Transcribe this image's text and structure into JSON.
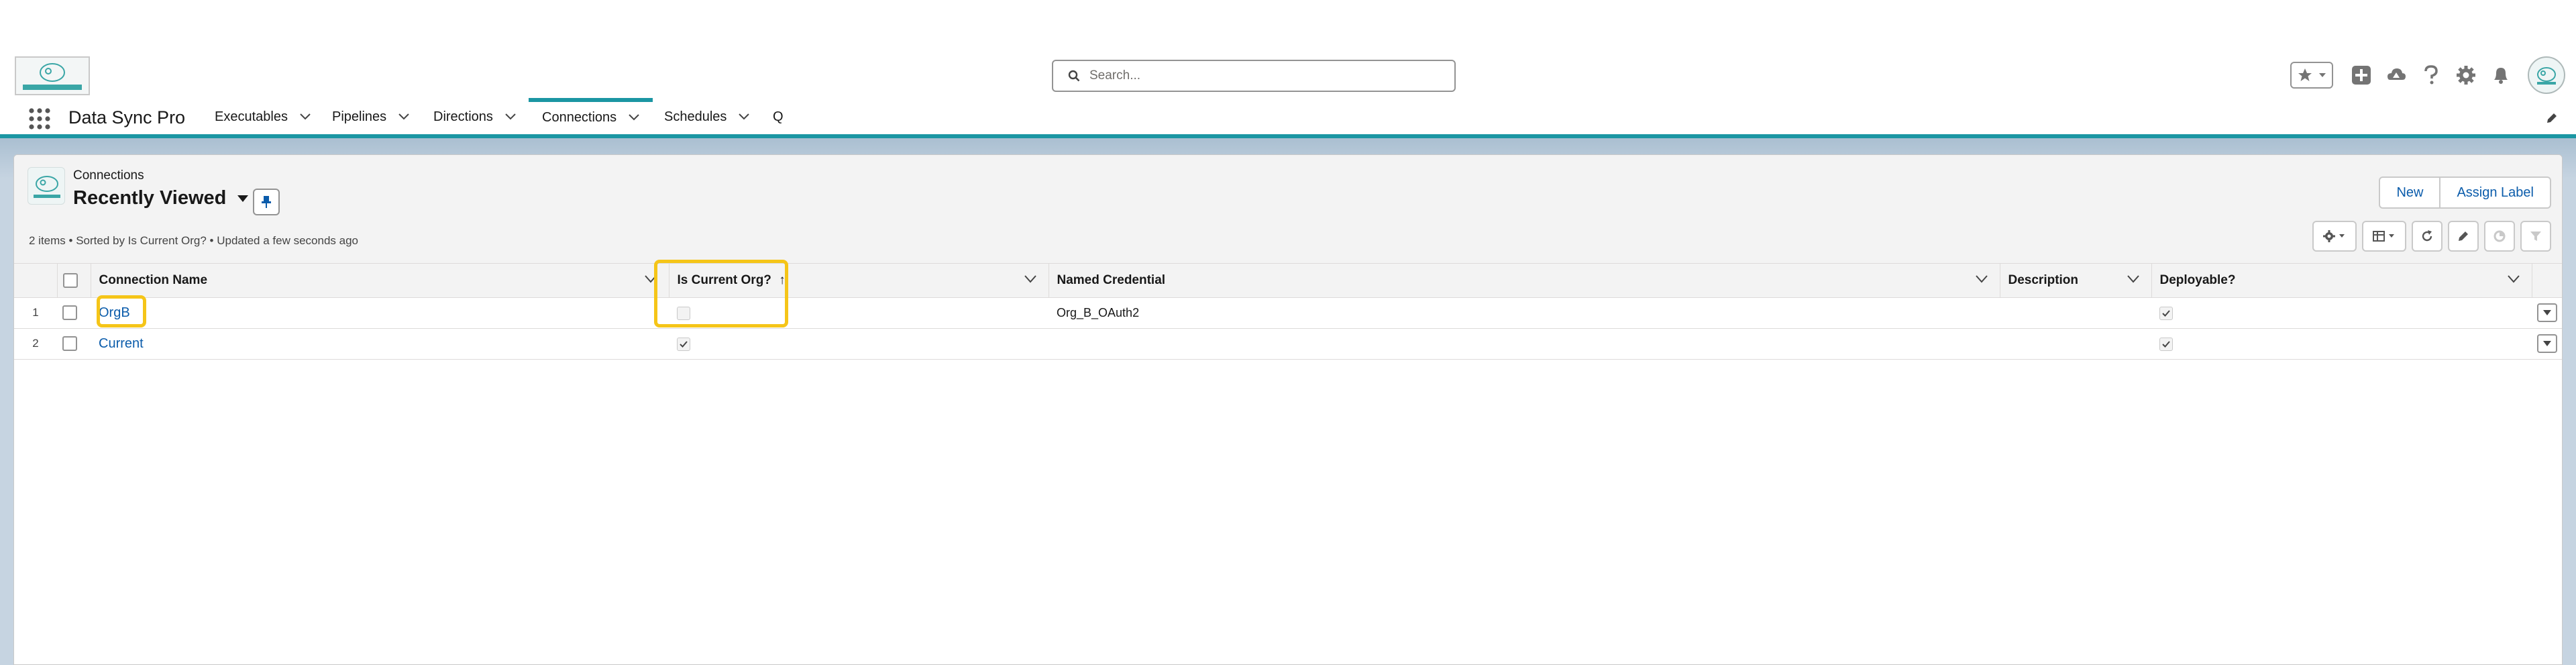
{
  "search": {
    "placeholder": "Search..."
  },
  "app": {
    "name": "Data Sync Pro"
  },
  "nav": {
    "items": [
      {
        "label": "Executables"
      },
      {
        "label": "Pipelines"
      },
      {
        "label": "Directions"
      },
      {
        "label": "Connections",
        "active": true
      },
      {
        "label": "Schedules"
      },
      {
        "label": "Q"
      }
    ]
  },
  "list": {
    "object_label": "Connections",
    "view_name": "Recently Viewed",
    "meta": "2 items • Sorted by Is Current Org? • Updated a few seconds ago",
    "buttons": {
      "new": "New",
      "assign_label": "Assign Label"
    },
    "columns": {
      "name": "Connection Name",
      "is_current": "Is Current Org?",
      "named_credential": "Named Credential",
      "description": "Description",
      "deployable": "Deployable?"
    },
    "sort_indicator": "↑",
    "rows": [
      {
        "num": "1",
        "name": "OrgB",
        "is_current": false,
        "named_credential": "Org_B_OAuth2",
        "description": "",
        "deployable": true
      },
      {
        "num": "2",
        "name": "Current",
        "is_current": true,
        "named_credential": "",
        "description": "",
        "deployable": true
      }
    ]
  },
  "colors": {
    "accent": "#1b96a3",
    "link": "#0b5cab",
    "highlight": "#f5c518"
  }
}
